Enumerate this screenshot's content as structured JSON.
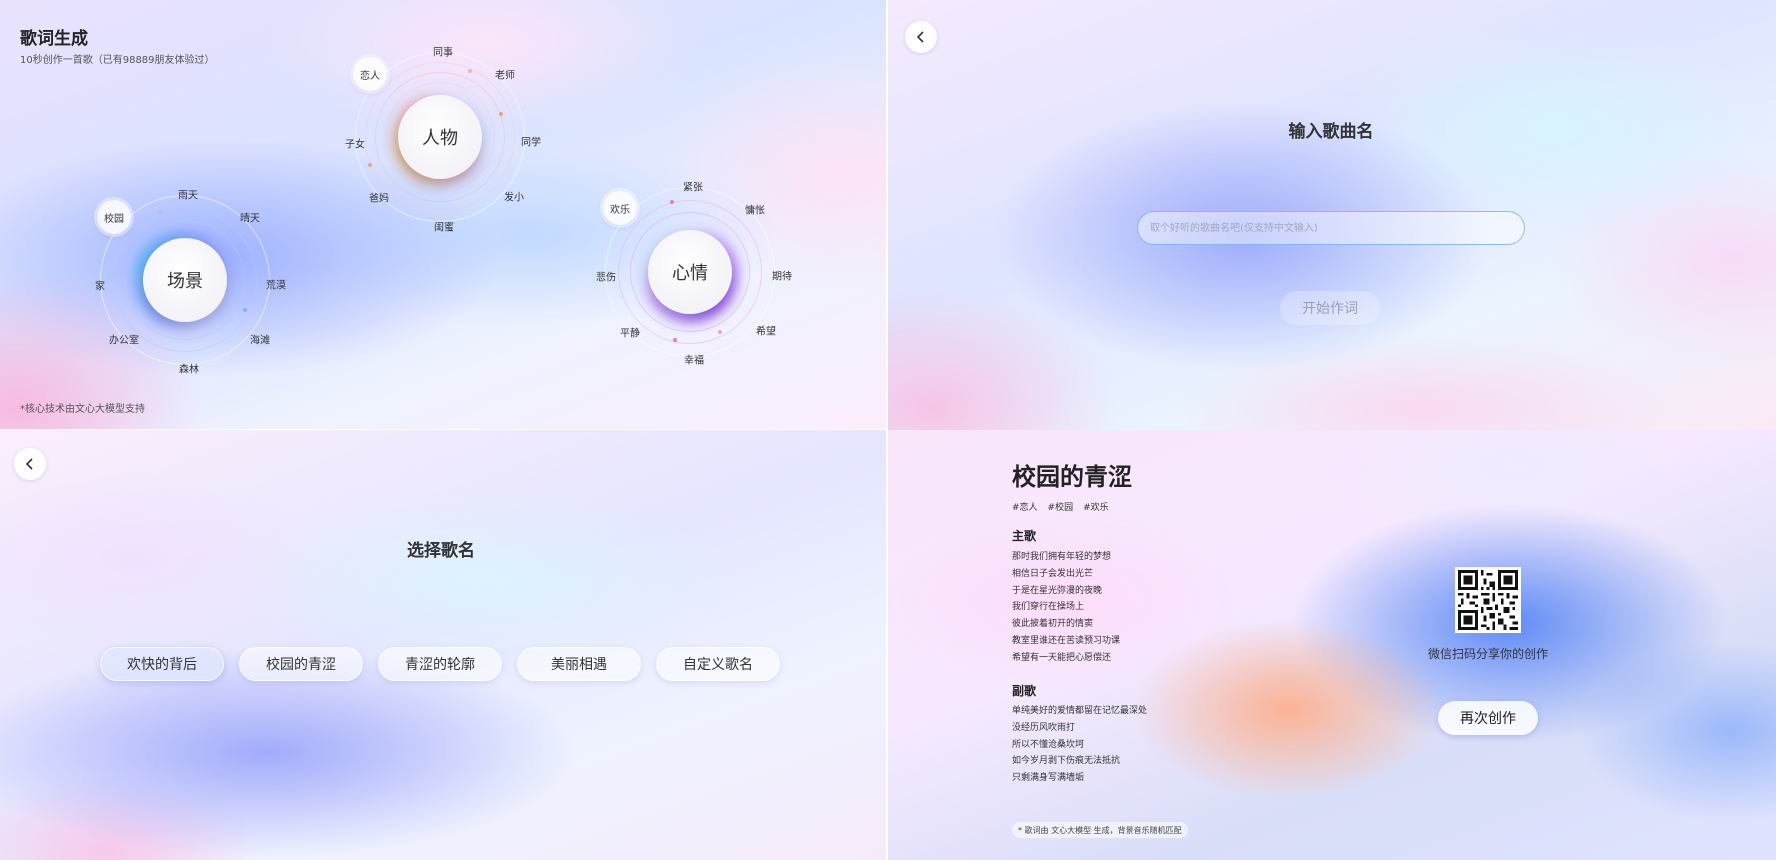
{
  "home": {
    "title": "歌词生成",
    "subtitle": "10秒创作一首歌（已有98889朋友体验过）",
    "footnote": "*核心技术由文心大模型支持",
    "clusters": {
      "people": {
        "center": "人物",
        "tags": [
          "同事",
          "老师",
          "同学",
          "发小",
          "闺蜜",
          "爸妈",
          "子女",
          "恋人"
        ],
        "selected": "恋人"
      },
      "scene": {
        "center": "场景",
        "tags": [
          "雨天",
          "晴天",
          "荒漠",
          "海滩",
          "森林",
          "办公室",
          "家",
          "校园"
        ],
        "selected": "校园"
      },
      "mood": {
        "center": "心情",
        "tags": [
          "紧张",
          "慵怅",
          "期待",
          "希望",
          "幸福",
          "平静",
          "悲伤",
          "欢乐"
        ],
        "selected": "欢乐"
      }
    }
  },
  "input_page": {
    "heading": "输入歌曲名",
    "placeholder": "取个好听的歌曲名吧(仅支持中文输入)",
    "start_label": "开始作词"
  },
  "choose_page": {
    "heading": "选择歌名",
    "options": [
      "欢快的背后",
      "校园的青涩",
      "青涩的轮廓",
      "美丽相遇",
      "自定义歌名"
    ],
    "selected": "欢快的背后"
  },
  "result_page": {
    "title": "校园的青涩",
    "tags": [
      "#恋人",
      "#校园",
      "#欢乐"
    ],
    "verse_label": "主歌",
    "verse": [
      "那时我们拥有年轻的梦想",
      "相信日子会发出光芒",
      "于是在星光弥漫的夜晚",
      "我们穿行在操场上",
      "彼此披着初开的情窦",
      "教室里谁还在苦读预习功课",
      "希望有一天能把心愿偿还"
    ],
    "chorus_label": "副歌",
    "chorus": [
      "单纯美好的爱情都留在记忆最深处",
      "没经历风吹雨打",
      "所以不懂沧桑坎坷",
      "如今岁月剥下伤痕无法抵抗",
      "只剩满身写满墙垢"
    ],
    "qr_caption": "微信扫码分享你的创作",
    "again_label": "再次创作",
    "footnote": "* 歌词由 文心大模型 生成，背景音乐随机匹配"
  },
  "colors": {
    "people_glow": "#f0b040",
    "scene_glow": "#4fb6f5",
    "mood_glow": "#8a4cf0",
    "input_border": "#78aafa"
  },
  "icons": {
    "back": "chevron-left-icon",
    "qr": "qr-code-icon"
  }
}
